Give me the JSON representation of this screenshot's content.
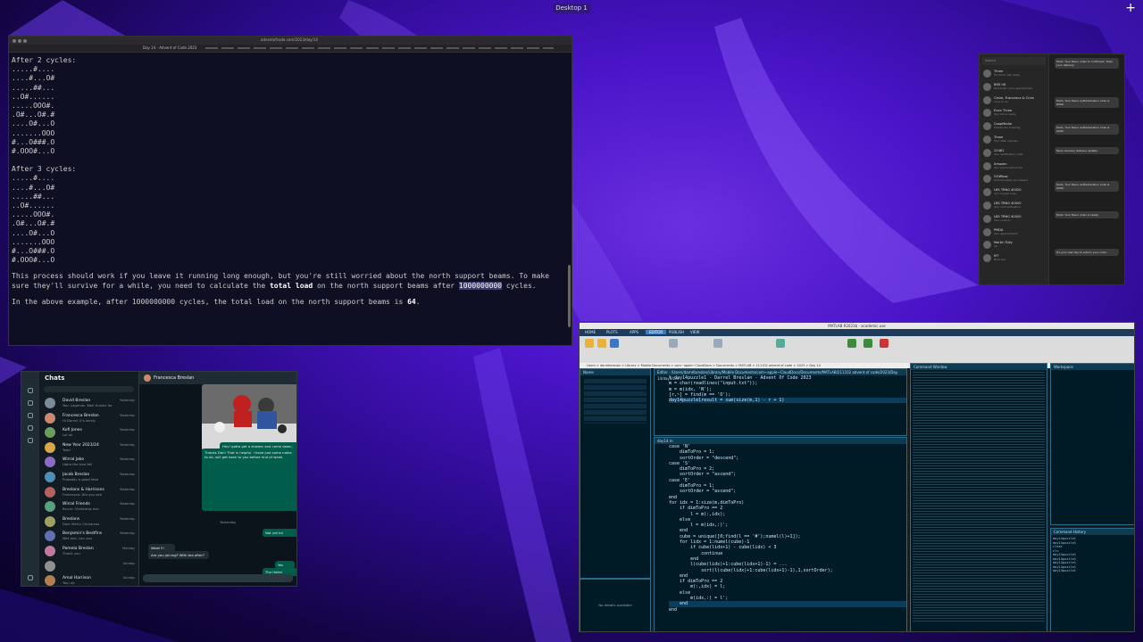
{
  "desktop": {
    "label": "Desktop 1",
    "plus": "+"
  },
  "browser": {
    "url": "adventofcode.com/2023/day/14",
    "tab_title": "Day 14 - Advent of Code 2023",
    "content": {
      "cycle2_heading": "After 2 cycles:",
      "cycle2_grid": [
        ".....#....",
        "....#...O#",
        ".....##...",
        "..O#......",
        ".....OOO#.",
        ".O#...O#.#",
        "....O#...O",
        ".......OOO",
        "#...O###.O",
        "#.OOO#...O"
      ],
      "cycle3_heading": "After 3 cycles:",
      "cycle3_grid": [
        ".....#....",
        "....#...O#",
        ".....##...",
        "..O#......",
        ".....OOO#.",
        ".O#...O#.#",
        "....O#...O",
        ".......OOO",
        "#...O###.O",
        "#.OOO#...O"
      ],
      "para1_a": "This process should work if you leave it running long enough, but you're still worried about the north support beams. To make sure they'll survive for a while, you need to calculate the ",
      "para1_bold": "total load",
      "para1_b": " on the north support beams after ",
      "para1_hl": "1000000000",
      "para1_c": " cycles.",
      "para2_a": "In the above example, after 1000000000 cycles, the total load on the north support beams is ",
      "para2_em": "64",
      "para2_b": "."
    }
  },
  "whatsapp": {
    "title": "Chats",
    "conversation_name": "Francesca Breslan",
    "chats": [
      {
        "name": "David Breslan",
        "preview": "You: Legends. Well thanks for",
        "time": "Yesterday",
        "color": "#7a8a99"
      },
      {
        "name": "Francesca Breslan",
        "preview": "Hi Darrel, it's lovely",
        "time": "Yesterday",
        "color": "#c98a70"
      },
      {
        "name": "Kofi Jones",
        "preview": "Lol ok",
        "time": "Yesterday",
        "color": "#6a9c5c"
      },
      {
        "name": "New Year 2023/24",
        "preview": "Yeah",
        "time": "Yesterday",
        "color": "#d6a84a"
      },
      {
        "name": "Wirral Jake",
        "preview": "Haha the tree fell",
        "time": "Yesterday",
        "color": "#8c6cc2"
      },
      {
        "name": "Jacob Breslan",
        "preview": "Probably a good idea",
        "time": "Yesterday",
        "color": "#4d8fb5"
      },
      {
        "name": "Breslans & Harrisons",
        "preview": "Francesca: Did you see",
        "time": "Yesterday",
        "color": "#b36060"
      },
      {
        "name": "Wirral Friends",
        "preview": "Bruce: Christmas eve",
        "time": "Yesterday",
        "color": "#5aa07a"
      },
      {
        "name": "Breslans",
        "preview": "Dad: Merry Christmas",
        "time": "Yesterday",
        "color": "#a0a060"
      },
      {
        "name": "Benjamin's Bestfins",
        "preview": "Wet one, can you",
        "time": "Yesterday",
        "color": "#6070b0"
      },
      {
        "name": "Pamela Breslan",
        "preview": "Thank you",
        "time": "Monday",
        "color": "#c07aa0"
      },
      {
        "name": "",
        "preview": "",
        "time": "Sunday",
        "color": "#909090"
      },
      {
        "name": "Amal Harrison",
        "preview": "You: ok",
        "time": "Sunday",
        "color": "#b08050"
      }
    ],
    "messages": [
      {
        "side": "out",
        "text": "Hey! gotta get a shower and come down, you coming?"
      },
      {
        "side": "out",
        "text": "Thanks Dan! That is helpful. I have just some notes to do, will get back to you before end of week."
      },
      {
        "side": "in",
        "text": "Wow!!!!"
      },
      {
        "side": "in",
        "text": "Are you joining? With tea after?"
      },
      {
        "side": "out",
        "text": "Not yet b4"
      },
      {
        "side": "out",
        "text": "Yes"
      },
      {
        "side": "out",
        "text": "Thx Helen"
      }
    ],
    "date_divider": "Yesterday"
  },
  "messages_app": {
    "search": "Search",
    "rows": [
      {
        "name": "Three",
        "preview": "It's time! Get ready"
      },
      {
        "name": "BRS UK",
        "preview": "Reminder: your appointment"
      },
      {
        "name": "Claire, Francesca & Chris",
        "preview": "Love to all"
      },
      {
        "name": "Evan Three",
        "preview": "Your bill is ready"
      },
      {
        "name": "CoopMedia",
        "preview": "Thanks for ordering"
      },
      {
        "name": "Three",
        "preview": "Your offer expires"
      },
      {
        "name": "22461",
        "preview": "Your verification code"
      },
      {
        "name": "Amazon",
        "preview": "Your parcel will arrive"
      },
      {
        "name": "GOWbox",
        "preview": "Unfortunately we missed"
      },
      {
        "name": "LBS TRNG 40020",
        "preview": "Your Lloyds code"
      },
      {
        "name": "LBS TRNG 40020",
        "preview": "Your card activation"
      },
      {
        "name": "LBS TRNG 40020",
        "preview": "Your code is"
      },
      {
        "name": "PMDA",
        "preview": "Your appointment"
      },
      {
        "name": "Martin Tully",
        "preview": "ok"
      },
      {
        "name": "MT",
        "preview": "Nice one"
      }
    ],
    "bubbles": [
      "Hello. Your Tesco order is confirmed. Track your delivery.",
      "Hello. Your Tesco authentication code is 0000.",
      "Hello. Your Tesco authentication code is 0000.",
      "Tesco Grocery delivery update.",
      "Hello. Your Tesco authentication code is 0000.",
      "Hello. Your Tesco order is ready.",
      "It's your last day to add to your order."
    ]
  },
  "matlab": {
    "title": "MATLAB R2023b - academic use",
    "tabs": [
      "HOME",
      "PLOTS",
      "APPS",
      "EDITOR",
      "PUBLISH",
      "VIEW"
    ],
    "active_tab": "EDITOR",
    "path": "Users > darrelbreslan > Library > Mobile Documents > com~apple~CloudDocs > Documents > MATLAB > 211102 advent of code > 2023 > Day 14",
    "editor_file": "day14.m",
    "editor_header": "Editor - /Users/darrelbreslan/Library/Mobile Documents/com~apple~CloudDocs/Documents/MATLAB/211102 advent of code/2023/Day 14/day14.m",
    "top_code": [
      "% day14puzzle1 - Darrel Breslan - Advent Of Code 2023",
      "m = char(readlines(\"input.txt\"));",
      "m = m(idx, 'N');",
      "[r,~] = find(m == 'O');",
      "day14puzzle1result = sum(size(m,1) - r + 1)"
    ],
    "bottom_code": [
      "case 'N'",
      "    dimToPro = 1;",
      "    sortOrder = \"descend\";",
      "case 'S'",
      "    dimToPro = 2;",
      "    sortOrder = \"ascend\";",
      "case 'E'",
      "    dimToPro = 1;",
      "    sortOrder = \"ascend\";",
      "end",
      "",
      "for idx = 1:size(m,dimToPro)",
      "    if dimToPro == 2",
      "        l = m(:,idx);",
      "    else",
      "        l = m(idx,:)';",
      "    end",
      "    cube = unique([0;find(l == '#');numel(l)+1]);",
      "    for lidx = 1:numel(cube)-1",
      "        if cube(lidx+1) - cube(lidx) < 3",
      "            continue",
      "        end",
      "        l(cube(lidx)+1:cube(lidx+1)-1) = ...",
      "            sort(l(cube(lidx)+1:cube(lidx+1)-1),1,sortOrder);",
      "    end",
      "    if dimToPro == 2",
      "        m(:,idx) = l;",
      "    else",
      "        m(idx,:) = l';",
      "    end",
      "end"
    ],
    "command_window_title": "Command Window",
    "workspace_title": "Workspace",
    "history_title": "Command History",
    "details": "No details available",
    "history": [
      "day14puzzle1",
      "day14puzzle1",
      "clear",
      "clc",
      "day14puzzle1",
      "day14puzzle1",
      "day14puzzle1",
      "day14puzzle1",
      "day14puzzle1"
    ]
  }
}
